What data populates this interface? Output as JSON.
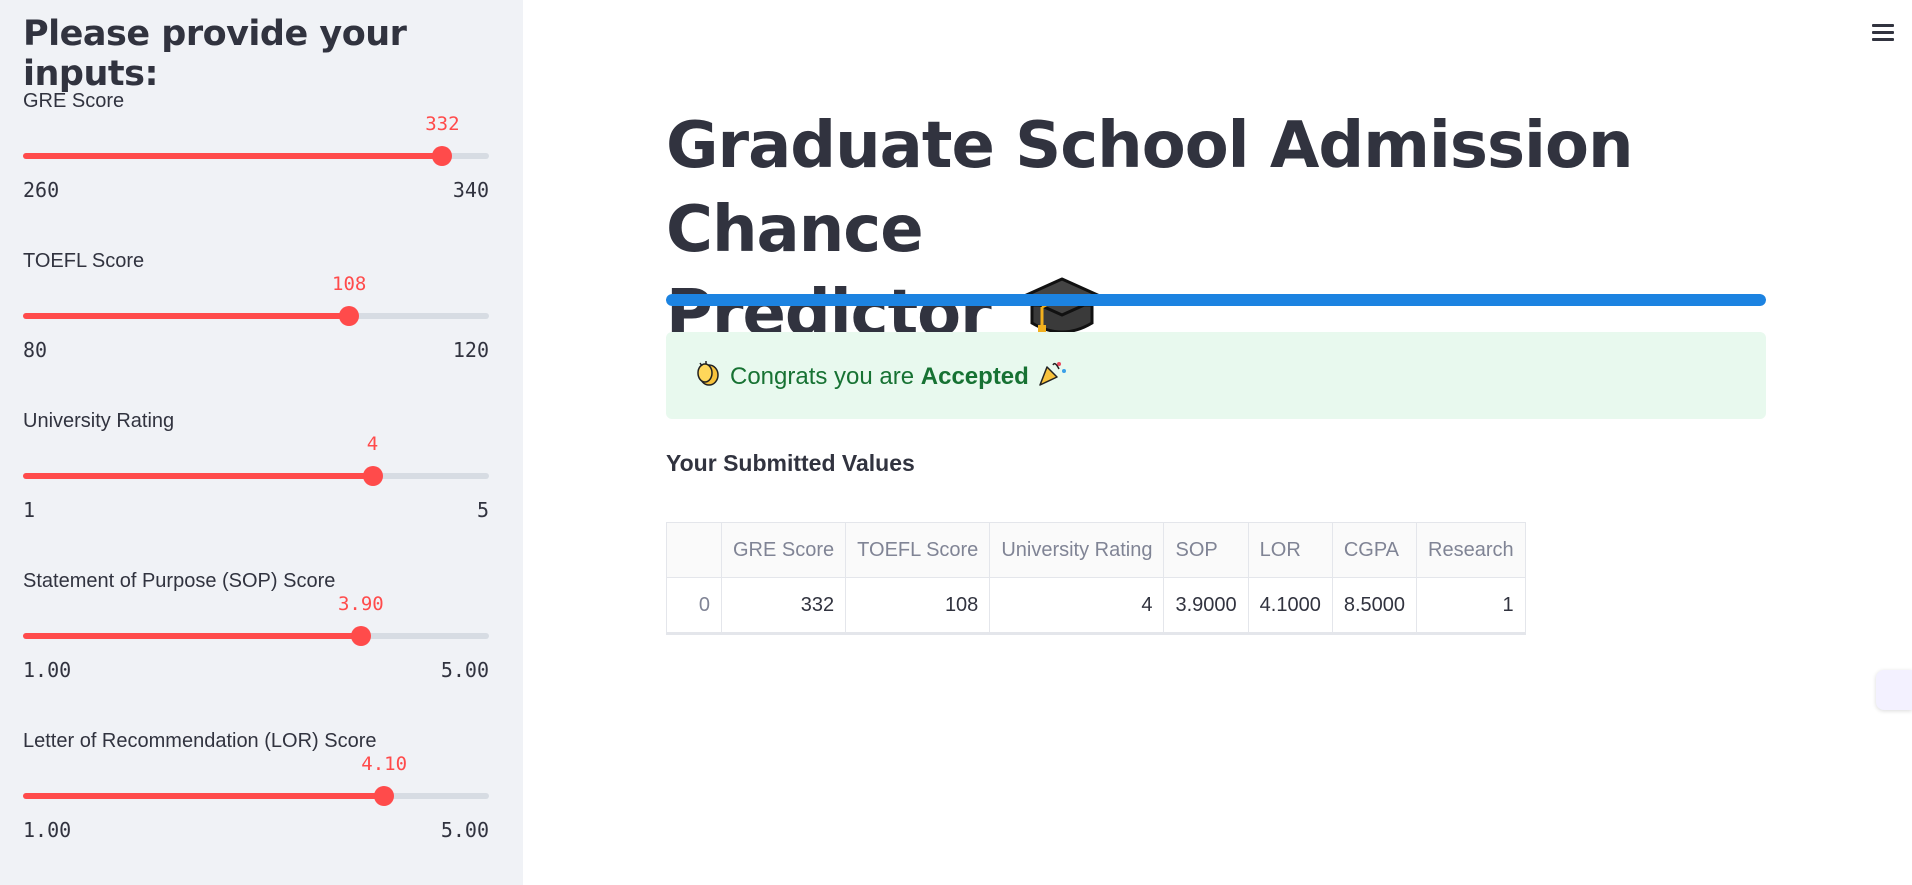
{
  "sidebar": {
    "title": "Please provide your inputs:",
    "sliders": [
      {
        "label": "GRE Score",
        "value": "332",
        "min": "260",
        "max": "340",
        "fraction": 0.9
      },
      {
        "label": "TOEFL Score",
        "value": "108",
        "min": "80",
        "max": "120",
        "fraction": 0.7
      },
      {
        "label": "University Rating",
        "value": "4",
        "min": "1",
        "max": "5",
        "fraction": 0.75
      },
      {
        "label": "Statement of Purpose (SOP) Score",
        "value": "3.90",
        "min": "1.00",
        "max": "5.00",
        "fraction": 0.725
      },
      {
        "label": "Letter of Recommendation (LOR) Score",
        "value": "4.10",
        "min": "1.00",
        "max": "5.00",
        "fraction": 0.775
      }
    ]
  },
  "main": {
    "title_line1": "Graduate School Admission Chance",
    "title_line2": "Predictor",
    "title_icon": "graduation-cap-icon",
    "progress_fraction": 1.0,
    "success": {
      "prefix": "Congrats you are",
      "emphasis": "Accepted",
      "leading_icon": "clapping-hands-icon",
      "trailing_icon": "party-popper-icon"
    },
    "subheading": "Your Submitted Values",
    "table": {
      "columns": [
        "",
        "GRE Score",
        "TOEFL Score",
        "University Rating",
        "SOP",
        "LOR",
        "CGPA",
        "Research"
      ],
      "rows": [
        [
          "0",
          "332",
          "108",
          "4",
          "3.9000",
          "4.1000",
          "8.5000",
          "1"
        ]
      ]
    }
  },
  "icons": {
    "menu": "hamburger-menu-icon"
  },
  "colors": {
    "accent": "#ff4b4b",
    "progress": "#1c83e1",
    "success_bg": "#e8f9ee",
    "success_text": "#177233",
    "sidebar_bg": "#f0f2f6"
  }
}
